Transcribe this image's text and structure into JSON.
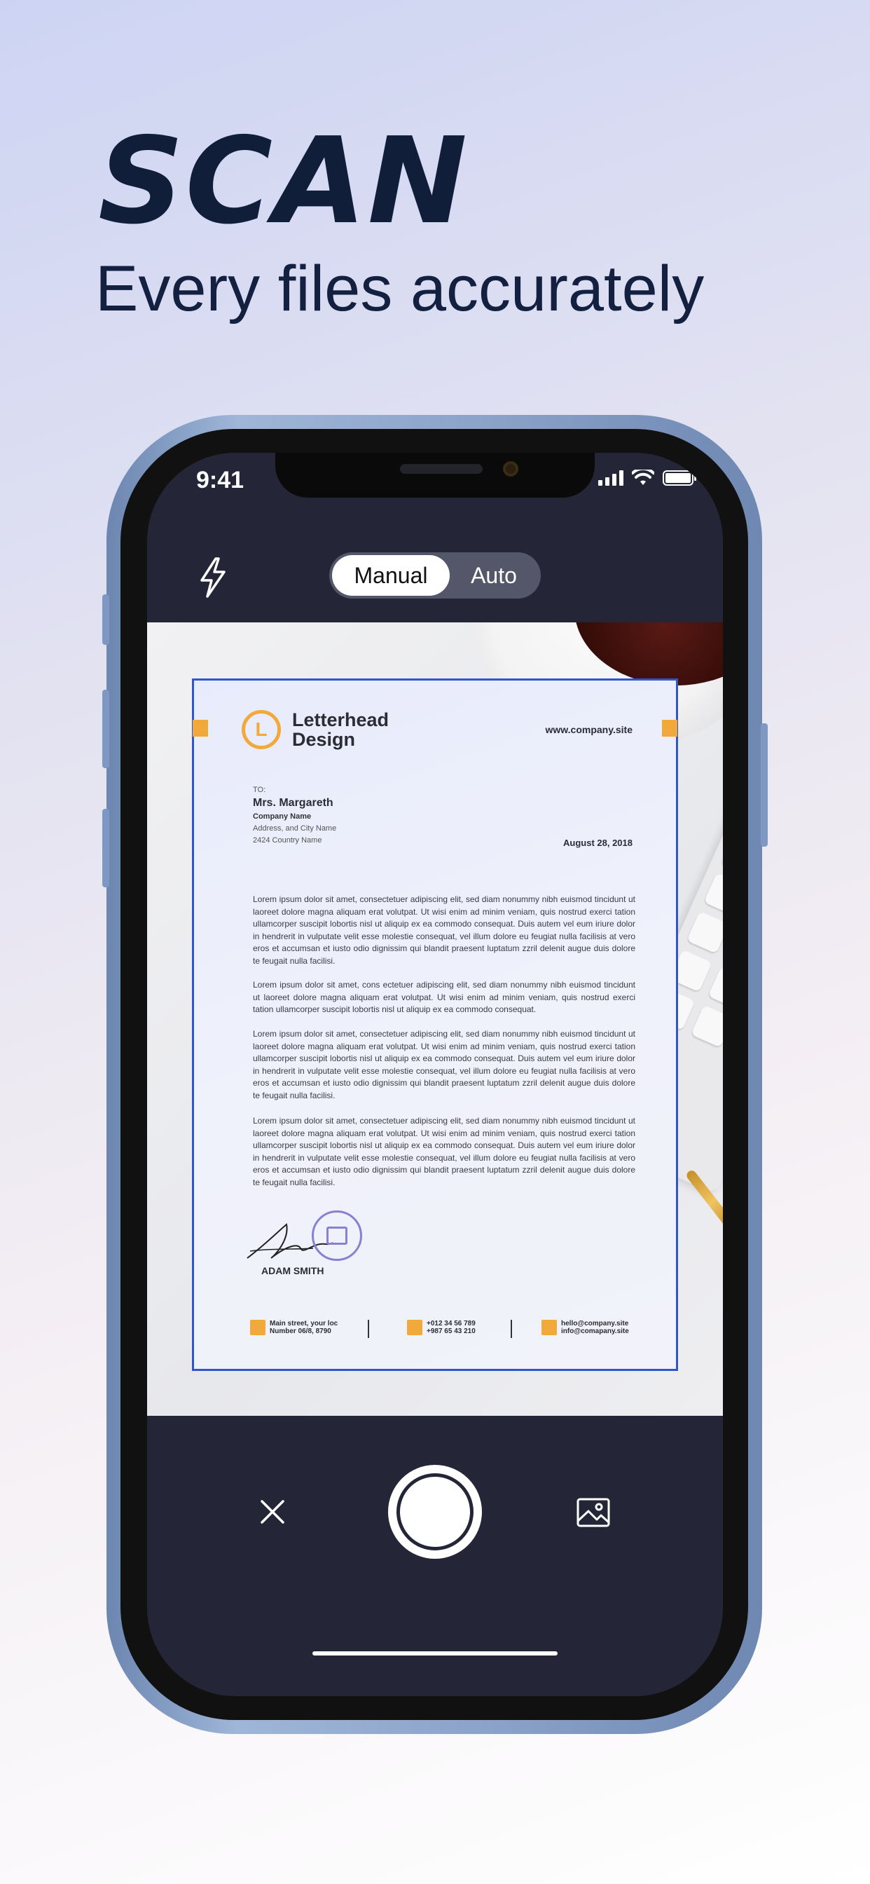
{
  "promo": {
    "headline": "SCAN",
    "subheadline": "Every files accurately"
  },
  "status_bar": {
    "time": "9:41",
    "icons": [
      "cellular-signal-icon",
      "wifi-icon",
      "battery-icon"
    ]
  },
  "toolbar": {
    "flash_icon": "flash-icon",
    "modes": [
      "Manual",
      "Auto"
    ],
    "selected_mode": "Manual"
  },
  "document": {
    "logo_letter": "L",
    "title_line1": "Letterhead",
    "title_line2": "Design",
    "website": "www.company.site",
    "to_label": "TO:",
    "recipient": "Mrs. Margareth",
    "company": "Company Name",
    "address1": "Address, and City Name",
    "address2": "2424 Country Name",
    "date": "August 28, 2018",
    "paragraphs": [
      "Lorem ipsum dolor sit amet, consectetuer adipiscing elit, sed diam nonummy nibh euismod tincidunt ut laoreet dolore magna aliquam erat volutpat. Ut wisi enim ad minim veniam, quis nostrud exerci tation ullamcorper suscipit lobortis nisl ut aliquip ex ea commodo consequat. Duis autem vel eum iriure dolor in hendrerit in vulputate velit esse molestie consequat, vel illum dolore eu feugiat nulla facilisis at vero eros et accumsan et iusto odio dignissim qui blandit praesent luptatum zzril delenit augue duis dolore te feugait nulla facilisi.",
      "Lorem ipsum dolor sit amet, cons ectetuer adipiscing elit, sed diam nonummy nibh euismod tincidunt ut laoreet dolore magna aliquam erat volutpat. Ut wisi enim ad minim veniam, quis nostrud exerci tation ullamcorper suscipit lobortis nisl ut aliquip ex ea commodo consequat.",
      "Lorem ipsum dolor sit amet, consectetuer adipiscing elit, sed diam nonummy nibh euismod tincidunt ut laoreet dolore magna aliquam erat volutpat. Ut wisi enim ad minim veniam, quis nostrud exerci tation ullamcorper suscipit lobortis nisl ut aliquip ex ea commodo consequat. Duis autem vel eum iriure dolor in hendrerit in vulputate velit esse molestie consequat, vel illum dolore eu feugiat nulla facilisis at vero eros et accumsan et iusto odio dignissim qui blandit praesent luptatum zzril delenit augue duis dolore te feugait nulla facilisi.",
      "Lorem ipsum dolor sit amet, consectetuer adipiscing elit, sed diam nonummy nibh euismod tincidunt ut laoreet dolore magna aliquam erat volutpat. Ut wisi enim ad minim veniam, quis nostrud exerci tation ullamcorper suscipit lobortis nisl ut aliquip ex ea commodo consequat. Duis autem vel eum iriure dolor in hendrerit in vulputate velit esse molestie consequat, vel illum dolore eu feugiat nulla facilisis at vero eros et accumsan et iusto odio dignissim qui blandit praesent luptatum zzril delenit augue duis dolore te feugait nulla facilisi."
    ],
    "signer": "ADAM SMITH",
    "footer": [
      {
        "line1": "Main street, your loc",
        "line2": "Number 06/8, 8790",
        "icon": "location-icon"
      },
      {
        "line1": "+012 34 56 789",
        "line2": "+987 65 43 210",
        "icon": "phone-icon"
      },
      {
        "line1": "hello@company.site",
        "line2": "info@comapany.site",
        "icon": "email-icon"
      }
    ]
  },
  "controls": {
    "close_icon": "close-icon",
    "shutter": "shutter-button",
    "gallery_icon": "gallery-icon"
  },
  "colors": {
    "headline": "#101e3a",
    "screen_bg": "#242637",
    "scan_border": "#3057c9",
    "accent_orange": "#f2a93b",
    "phone_frame": "#8aa2c8"
  }
}
